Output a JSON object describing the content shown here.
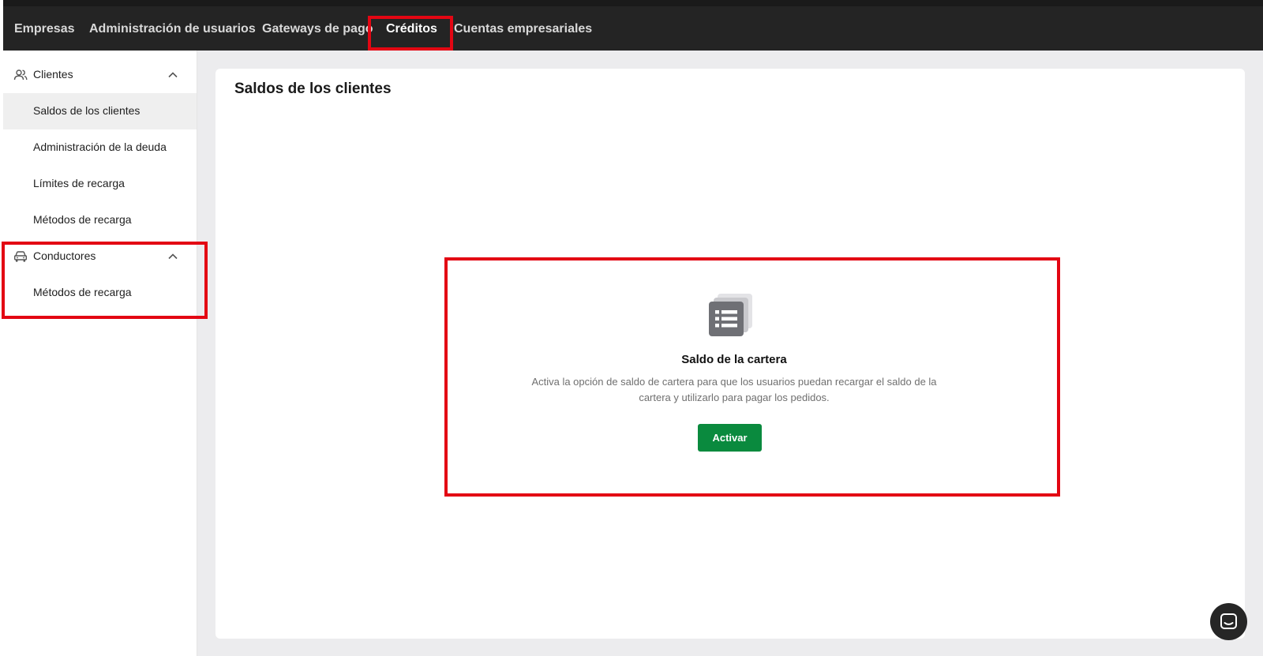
{
  "topnav": {
    "items": [
      {
        "label": "Empresas",
        "active": false
      },
      {
        "label": "Administración de usuarios",
        "active": false
      },
      {
        "label": "Gateways de pago",
        "active": false
      },
      {
        "label": "Créditos",
        "active": true
      },
      {
        "label": "Cuentas empresariales",
        "active": false
      }
    ]
  },
  "sidebar": {
    "groups": [
      {
        "label": "Clientes",
        "icon": "users-icon",
        "expanded": true,
        "items": [
          {
            "label": "Saldos de los clientes",
            "selected": true
          },
          {
            "label": "Administración de la deuda",
            "selected": false
          },
          {
            "label": "Límites de recarga",
            "selected": false
          },
          {
            "label": "Métodos de recarga",
            "selected": false
          }
        ]
      },
      {
        "label": "Conductores",
        "icon": "car-icon",
        "expanded": true,
        "items": [
          {
            "label": "Métodos de recarga",
            "selected": false
          }
        ]
      }
    ]
  },
  "main": {
    "title": "Saldos de los clientes",
    "empty_state": {
      "icon": "list-document-icon",
      "title": "Saldo de la cartera",
      "description": "Activa la opción de saldo de cartera para que los usuarios puedan recargar el saldo de la cartera y utilizarlo para pagar los pedidos.",
      "button_label": "Activar"
    }
  },
  "chat": {
    "icon": "chat-bubble-icon"
  },
  "colors": {
    "topbar_bg": "#242424",
    "highlight": "#e30613",
    "primary_button": "#0a8a3e",
    "content_bg": "#ececee"
  }
}
